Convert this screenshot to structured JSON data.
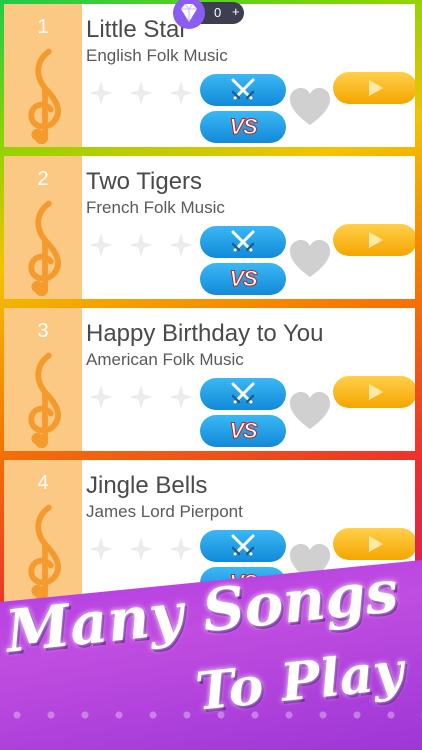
{
  "gems": {
    "count": "0",
    "plus": "+"
  },
  "songs": [
    {
      "number": "1",
      "title": "Little Star",
      "artist": "English Folk Music"
    },
    {
      "number": "2",
      "title": "Two Tigers",
      "artist": "French Folk Music"
    },
    {
      "number": "3",
      "title": "Happy Birthday to You",
      "artist": "American Folk Music"
    },
    {
      "number": "4",
      "title": "Jingle Bells",
      "artist": "James Lord Pierpont"
    }
  ],
  "buttons": {
    "vs_label": "VS"
  },
  "banner": {
    "line1": "Many Songs",
    "line2": "To Play"
  },
  "colors": {
    "card_side": "#fbc983",
    "clef": "#f59a2c",
    "blue_button": "#1e9be6",
    "play_button": "#f8b900",
    "banner": "#b13be4"
  },
  "icons": {
    "gem": "diamond-icon",
    "clef": "treble-clef-icon",
    "star": "star-icon",
    "battle": "crossed-swords-icon",
    "favorite": "heart-icon",
    "play": "play-icon"
  }
}
